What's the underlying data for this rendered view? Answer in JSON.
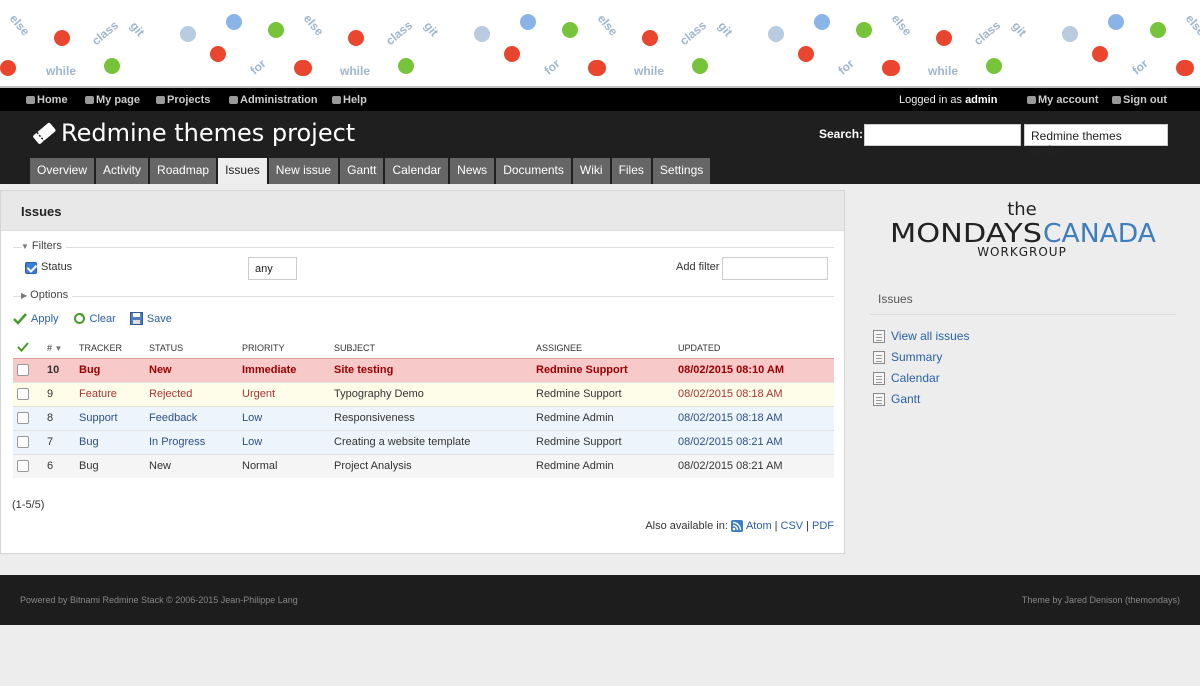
{
  "banner": {
    "words": [
      "else",
      "class",
      "git",
      "while",
      "for"
    ]
  },
  "top_menu": {
    "home": "Home",
    "my_page": "My page",
    "projects": "Projects",
    "administration": "Administration",
    "help": "Help",
    "logged_in_as": "Logged in as",
    "user": "admin",
    "my_account": "My account",
    "sign_out": "Sign out"
  },
  "header": {
    "project_title": "Redmine themes project",
    "search_label": "Search:",
    "search_value": "",
    "project_jump": "Redmine themes project"
  },
  "tabs": [
    "Overview",
    "Activity",
    "Roadmap",
    "Issues",
    "New issue",
    "Gantt",
    "Calendar",
    "News",
    "Documents",
    "Wiki",
    "Files",
    "Settings"
  ],
  "selected_tab": "Issues",
  "content": {
    "title": "Issues",
    "filters_legend": "Filters",
    "status_label": "Status",
    "status_value": "any",
    "add_filter_label": "Add filter",
    "options_legend": "Options",
    "apply": "Apply",
    "clear": "Clear",
    "save": "Save"
  },
  "table": {
    "headers": [
      "#",
      "TRACKER",
      "STATUS",
      "PRIORITY",
      "SUBJECT",
      "ASSIGNEE",
      "UPDATED"
    ],
    "rows": [
      {
        "id": "10",
        "tracker": "Bug",
        "status": "New",
        "priority": "Immediate",
        "subject": "Site testing",
        "assignee": "Redmine Support",
        "updated": "08/02/2015 08:10 AM"
      },
      {
        "id": "9",
        "tracker": "Feature",
        "status": "Rejected",
        "priority": "Urgent",
        "subject": "Typography Demo",
        "assignee": "Redmine Support",
        "updated": "08/02/2015 08:18 AM"
      },
      {
        "id": "8",
        "tracker": "Support",
        "status": "Feedback",
        "priority": "Low",
        "subject": "Responsiveness",
        "assignee": "Redmine Admin",
        "updated": "08/02/2015 08:18 AM"
      },
      {
        "id": "7",
        "tracker": "Bug",
        "status": "In Progress",
        "priority": "Low",
        "subject": "Creating a website template",
        "assignee": "Redmine Support",
        "updated": "08/02/2015 08:21 AM"
      },
      {
        "id": "6",
        "tracker": "Bug",
        "status": "New",
        "priority": "Normal",
        "subject": "Project Analysis",
        "assignee": "Redmine Admin",
        "updated": "08/02/2015 08:21 AM"
      }
    ]
  },
  "pagination": "(1-5/5)",
  "other_formats": {
    "label": "Also available in:",
    "atom": "Atom",
    "csv": "CSV",
    "pdf": "PDF",
    "sep": "|"
  },
  "sidebar": {
    "logo_the": "the",
    "logo_mondays": "MONDAYS",
    "logo_canada": "CANADA",
    "logo_workgroup": "WORKGROUP",
    "heading": "Issues",
    "links": [
      "View all issues",
      "Summary",
      "Calendar",
      "Gantt"
    ]
  },
  "footer": {
    "left": "Powered by Bitnami Redmine Stack © 2006-2015 Jean-Philippe Lang",
    "right": "Theme by Jared Denison (themondays)"
  },
  "colors": {
    "accent_link": "#2a5fa8",
    "immediate_row": "#f8c9c9",
    "header_bg": "#1f1f1f",
    "logo_blue": "#3d7ebf"
  }
}
